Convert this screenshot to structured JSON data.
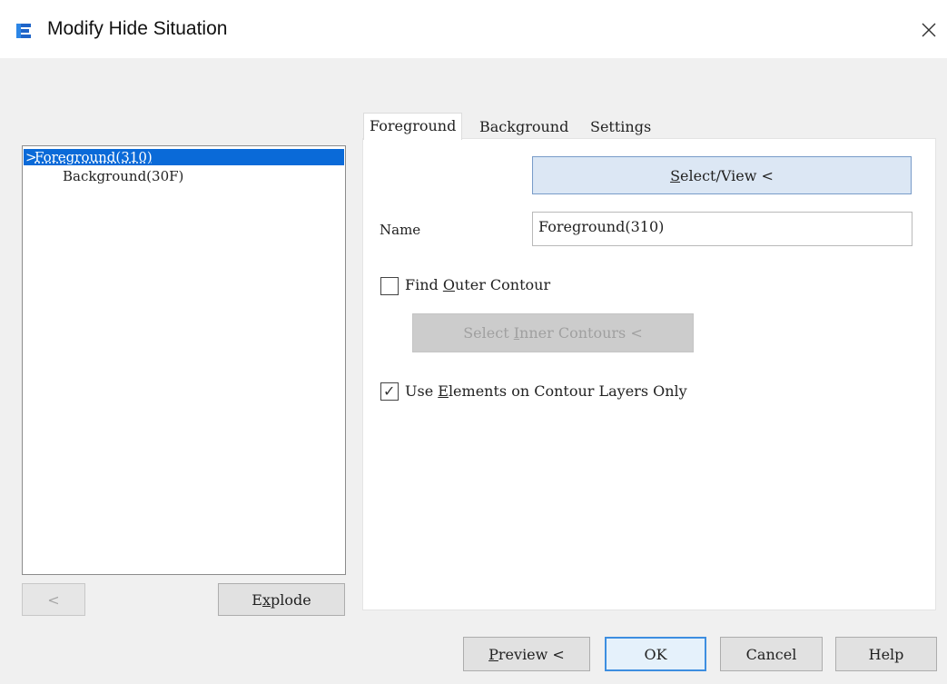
{
  "window": {
    "title": "Modify Hide Situation",
    "close_glyph": "×",
    "icon": "app-logo-icon",
    "accent_color": "#0a6ad8"
  },
  "tree": {
    "items": [
      {
        "prefix": ">",
        "label": "Foreground(310)",
        "selected": true
      },
      {
        "prefix": "",
        "label": "Background(30F)",
        "selected": false
      }
    ]
  },
  "left_buttons": {
    "back_label": "<",
    "explode_label": {
      "pre": "E",
      "accel": "x",
      "post": "plode"
    }
  },
  "tabs": [
    {
      "label": "Foreground",
      "active": true
    },
    {
      "label": "Background",
      "active": false
    },
    {
      "label": "Settings",
      "active": false
    }
  ],
  "foreground_tab": {
    "select_view_button": {
      "pre": "",
      "accel": "S",
      "post": "elect/View  <"
    },
    "name_label": "Name",
    "name_value": "Foreground(310)",
    "find_outer_contour": {
      "pre": "Find ",
      "accel": "O",
      "post": "uter Contour",
      "checked": false
    },
    "select_inner_button": {
      "pre": "Select ",
      "accel": "I",
      "post": "nner Contours <",
      "enabled": false
    },
    "use_elements": {
      "pre": "Use ",
      "accel": "E",
      "post": "lements on Contour Layers Only",
      "checked": true
    }
  },
  "footer": {
    "preview": {
      "pre": "",
      "accel": "P",
      "post": "review <"
    },
    "ok_label": "OK",
    "cancel_label": "Cancel",
    "help_label": "Help"
  }
}
